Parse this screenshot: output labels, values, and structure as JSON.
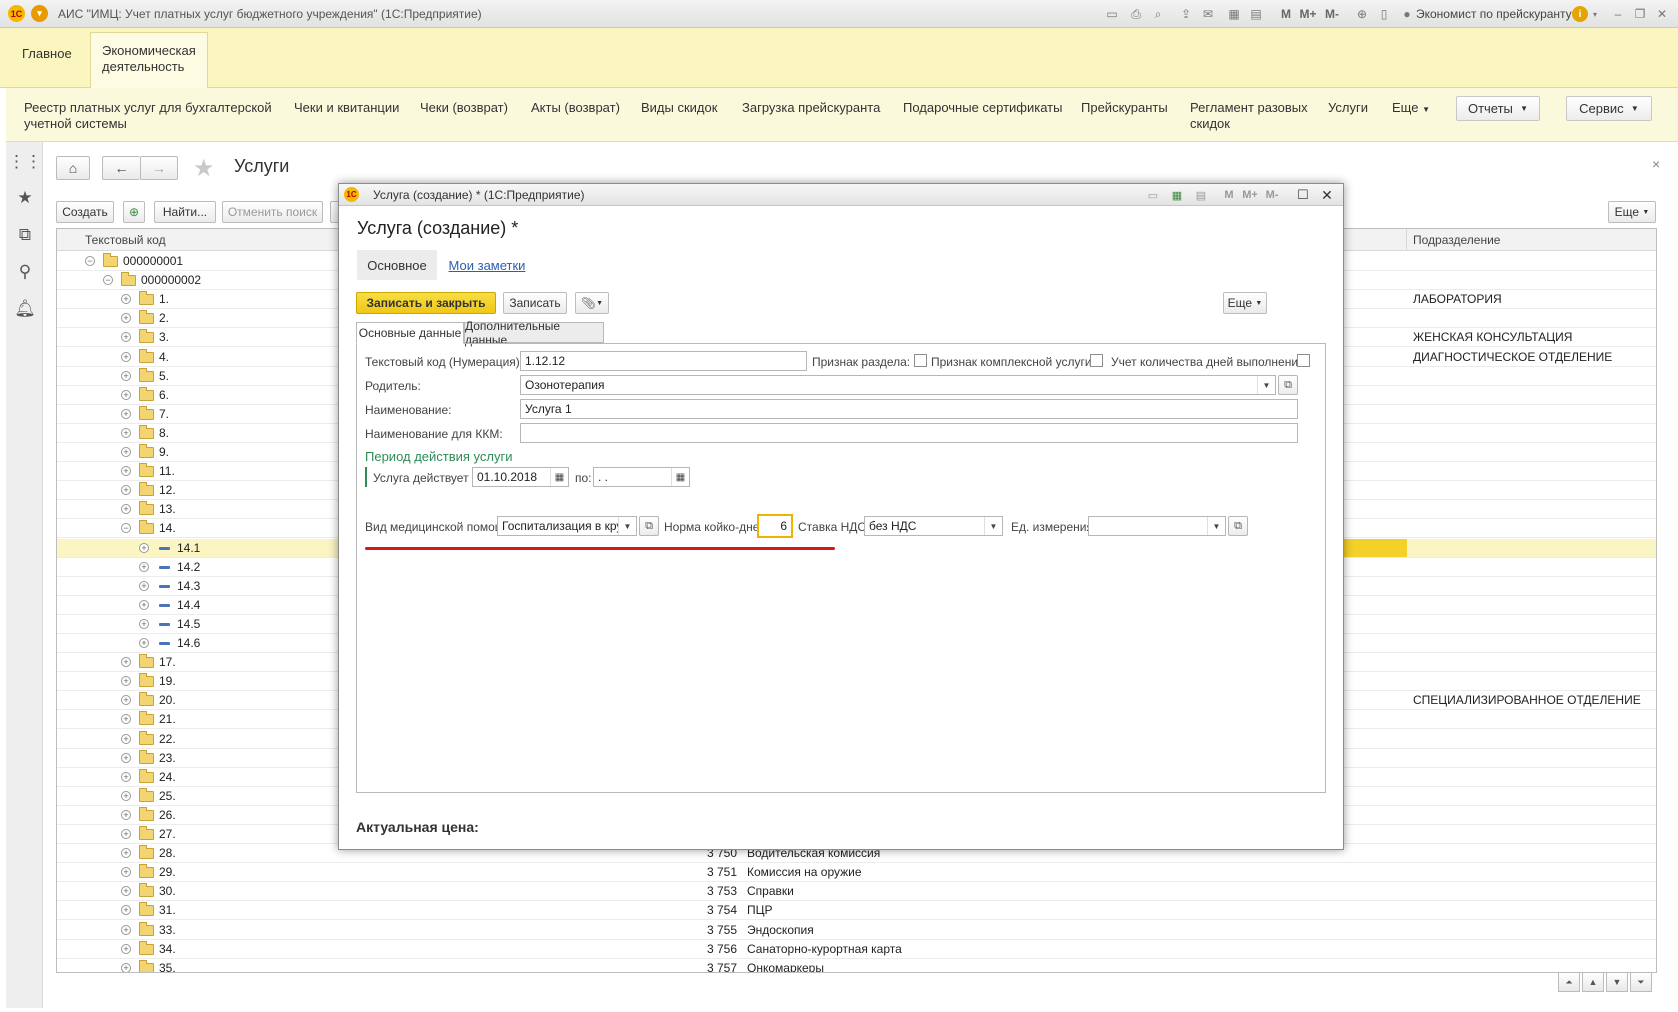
{
  "app": {
    "title": "АИС \"ИМЦ: Учет платных услуг бюджетного учреждения\"  (1С:Предприятие)",
    "user": "Экономист по прейскуранту",
    "toolbar_letters": [
      "M",
      "M+",
      "M-"
    ]
  },
  "sections": {
    "main": "Главное",
    "econ_line1": "Экономическая",
    "econ_line2": "деятельность"
  },
  "functions": {
    "items": [
      {
        "line1": "Реестр платных услуг для бухгалтерской",
        "line2": "учетной системы"
      },
      {
        "line1": "Чеки и квитанции",
        "line2": ""
      },
      {
        "line1": "Чеки (возврат)",
        "line2": ""
      },
      {
        "line1": "Акты (возврат)",
        "line2": ""
      },
      {
        "line1": "Виды скидок",
        "line2": ""
      },
      {
        "line1": "Загрузка прейскуранта",
        "line2": ""
      },
      {
        "line1": "Подарочные сертификаты",
        "line2": ""
      },
      {
        "line1": "Прейскуранты",
        "line2": ""
      },
      {
        "line1": "Регламент разовых",
        "line2": "скидок"
      },
      {
        "line1": "Услуги",
        "line2": ""
      }
    ],
    "more": "Еще",
    "reports": "Отчеты",
    "service": "Сервис"
  },
  "list": {
    "title": "Услуги",
    "btn_create": "Создать",
    "btn_find": "Найти...",
    "btn_cancel_search": "Отменить поиск",
    "btn_more": "Еще",
    "col_code": "Текстовый код",
    "col_dept": "Подразделение",
    "rows": [
      {
        "t": "000000001",
        "lvl": 0,
        "kind": "group",
        "tog": "−"
      },
      {
        "t": "000000002",
        "lvl": 1,
        "kind": "group",
        "tog": "−"
      },
      {
        "t": "1.",
        "lvl": 2,
        "kind": "group",
        "tog": "+",
        "dept": "ЛАБОРАТОРИЯ"
      },
      {
        "t": "2.",
        "lvl": 2,
        "kind": "group",
        "tog": "+"
      },
      {
        "t": "3.",
        "lvl": 2,
        "kind": "group",
        "tog": "+",
        "dept": "ЖЕНСКАЯ КОНСУЛЬТАЦИЯ"
      },
      {
        "t": "4.",
        "lvl": 2,
        "kind": "group",
        "tog": "+",
        "dept": "ДИАГНОСТИЧЕСКОЕ ОТДЕЛЕНИЕ"
      },
      {
        "t": "5.",
        "lvl": 2,
        "kind": "group",
        "tog": "+"
      },
      {
        "t": "6.",
        "lvl": 2,
        "kind": "group",
        "tog": "+"
      },
      {
        "t": "7.",
        "lvl": 2,
        "kind": "group",
        "tog": "+"
      },
      {
        "t": "8.",
        "lvl": 2,
        "kind": "group",
        "tog": "+"
      },
      {
        "t": "9.",
        "lvl": 2,
        "kind": "group",
        "tog": "+"
      },
      {
        "t": "11.",
        "lvl": 2,
        "kind": "group",
        "tog": "+"
      },
      {
        "t": "12.",
        "lvl": 2,
        "kind": "group",
        "tog": "+"
      },
      {
        "t": "13.",
        "lvl": 2,
        "kind": "group",
        "tog": "+"
      },
      {
        "t": "14.",
        "lvl": 2,
        "kind": "group",
        "tog": "−"
      },
      {
        "t": "14.1",
        "lvl": 3,
        "kind": "item",
        "tog": "+",
        "sel": true
      },
      {
        "t": "14.2",
        "lvl": 3,
        "kind": "item",
        "tog": "+"
      },
      {
        "t": "14.3",
        "lvl": 3,
        "kind": "item",
        "tog": "+"
      },
      {
        "t": "14.4",
        "lvl": 3,
        "kind": "item",
        "tog": "+"
      },
      {
        "t": "14.5",
        "lvl": 3,
        "kind": "item",
        "tog": "+"
      },
      {
        "t": "14.6",
        "lvl": 3,
        "kind": "item",
        "tog": "+"
      },
      {
        "t": "17.",
        "lvl": 2,
        "kind": "group",
        "tog": "+"
      },
      {
        "t": "19.",
        "lvl": 2,
        "kind": "group",
        "tog": "+"
      },
      {
        "t": "20.",
        "lvl": 2,
        "kind": "group",
        "tog": "+",
        "dept": "СПЕЦИАЛИЗИРОВАННОЕ ОТДЕЛЕНИЕ"
      },
      {
        "t": "21.",
        "lvl": 2,
        "kind": "group",
        "tog": "+"
      },
      {
        "t": "22.",
        "lvl": 2,
        "kind": "group",
        "tog": "+"
      },
      {
        "t": "23.",
        "lvl": 2,
        "kind": "group",
        "tog": "+"
      },
      {
        "t": "24.",
        "lvl": 2,
        "kind": "group",
        "tog": "+"
      },
      {
        "t": "25.",
        "lvl": 2,
        "kind": "group",
        "tog": "+"
      },
      {
        "t": "26.",
        "lvl": 2,
        "kind": "group",
        "tog": "+"
      },
      {
        "t": "27.",
        "lvl": 2,
        "kind": "group",
        "tog": "+"
      },
      {
        "t": "28.",
        "lvl": 2,
        "kind": "group",
        "tog": "+",
        "num": "3 750",
        "name": "Водительская комиссия"
      },
      {
        "t": "29.",
        "lvl": 2,
        "kind": "group",
        "tog": "+",
        "num": "3 751",
        "name": "Комиссия на оружие"
      },
      {
        "t": "30.",
        "lvl": 2,
        "kind": "group",
        "tog": "+",
        "num": "3 753",
        "name": "Справки"
      },
      {
        "t": "31.",
        "lvl": 2,
        "kind": "group",
        "tog": "+",
        "num": "3 754",
        "name": "ПЦР"
      },
      {
        "t": "33.",
        "lvl": 2,
        "kind": "group",
        "tog": "+",
        "num": "3 755",
        "name": "Эндоскопия"
      },
      {
        "t": "34.",
        "lvl": 2,
        "kind": "group",
        "tog": "+",
        "num": "3 756",
        "name": "Санаторно-курортная карта"
      },
      {
        "t": "35.",
        "lvl": 2,
        "kind": "group",
        "tog": "+",
        "num": "3 757",
        "name": "Онкомаркеры"
      }
    ]
  },
  "modal": {
    "window_title": "Услуга (создание) * (1С:Предприятие)",
    "header": "Услуга (создание) *",
    "tab_main": "Основное",
    "tab_notes": "Мои заметки",
    "btn_save_close": "Записать и закрыть",
    "btn_save": "Записать",
    "btn_more": "Еще",
    "subtab_main": "Основные данные",
    "subtab_extra": "Дополнительные данные",
    "lbl_code": "Текстовый код (Нумерация):",
    "val_code": "1.12.12",
    "lbl_section_flag": "Признак раздела:",
    "lbl_complex_flag": "Признак комплексной услуги:",
    "lbl_days_flag": "Учет количества дней выполнения:",
    "lbl_parent": "Родитель:",
    "val_parent": "Озонотерапия",
    "lbl_name": "Наименование:",
    "val_name": "Услуга 1",
    "lbl_kkm": "Наименование для ККМ:",
    "val_kkm": "",
    "period_title": "Период действия услуги",
    "lbl_from": "Услуга действует с:",
    "val_from": "01.10.2018",
    "lbl_to": "по:",
    "val_to": " .  .",
    "lbl_care": "Вид медицинской помощи:",
    "val_care": "Госпитализация в круглосуточный стационар",
    "lbl_beddays": "Норма койко-дней:",
    "val_beddays": "6",
    "lbl_vat": "Ставка НДС:",
    "val_vat": "без НДС",
    "lbl_unit": "Ед. измерения:",
    "val_unit": "",
    "price_label": "Актуальная цена:"
  },
  "colors": {
    "sections_bg": "#fbf5bf",
    "primary_button": "#f3d128",
    "highlight_underline": "#d21a1a",
    "period_title": "#2e8b57"
  }
}
